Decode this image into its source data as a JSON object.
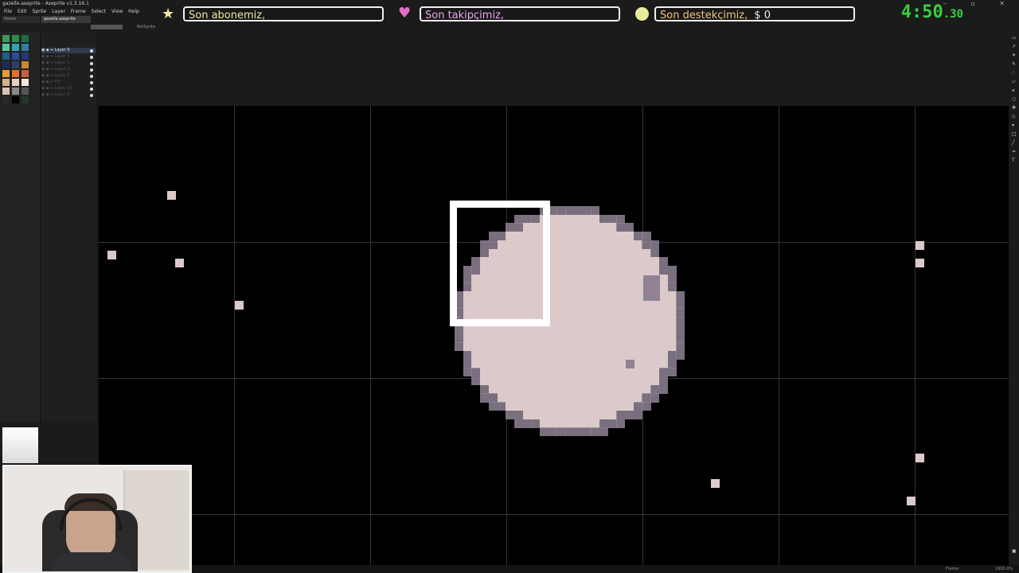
{
  "window": {
    "title": "gazelle.aseprite - Aseprite v1.3.16.1",
    "menu": [
      "File",
      "Edit",
      "Sprite",
      "Layer",
      "Frame",
      "Select",
      "View",
      "Help"
    ]
  },
  "tabs": [
    "Home",
    "gazelle.aseprite"
  ],
  "overlay": {
    "subscriber_label": "Son abonemiz,",
    "follower_label": "Son takipçimiz,",
    "donor_label": "Son destekçimiz,",
    "donor_amount": "$ 0",
    "timer_main": "4:50",
    "timer_fraction": ".30",
    "star_icon": "star-icon",
    "heart_icon": "heart-icon",
    "coin_icon": "coin-icon",
    "subscriber_color": "#f1e9a3",
    "follower_color": "#e8a8f0",
    "donor_color": "#f0c57a",
    "timer_color": "#36d043"
  },
  "toolbar": {
    "mode_label": "RotSprite"
  },
  "layers": [
    {
      "name": "Layer 0",
      "active": true
    },
    {
      "name": "Layer 5",
      "active": false
    },
    {
      "name": "Layer 1",
      "active": false
    },
    {
      "name": "Layer 2",
      "active": false
    },
    {
      "name": "Layer 9",
      "active": false
    },
    {
      "name": "Fill",
      "active": false
    },
    {
      "name": "Layer 10",
      "active": false
    },
    {
      "name": "Layer 3",
      "active": false
    }
  ],
  "palette": [
    "#3b9a5d",
    "#2f8a4f",
    "#1f6b43",
    "#55c7a0",
    "#3aa3b3",
    "#2f7ea0",
    "#215e8a",
    "#2a4a9a",
    "#22377a",
    "#1d2a5a",
    "#2a3f6e",
    "#c98a2a",
    "#e39a3a",
    "#e86f2a",
    "#c9603a",
    "#cdb38a",
    "#e7d2bf",
    "#f2e6da",
    "#d9c4b9",
    "#8a8a8a",
    "#555555",
    "#2a2a2a",
    "#000000",
    "#1f3a2a"
  ],
  "status": {
    "frame_label": "Frame:",
    "zoom_label": "1600.0%"
  },
  "canvas_colors": {
    "pixel": "#dccaca",
    "shade": "#8e8294",
    "selection": "#ffffff"
  }
}
